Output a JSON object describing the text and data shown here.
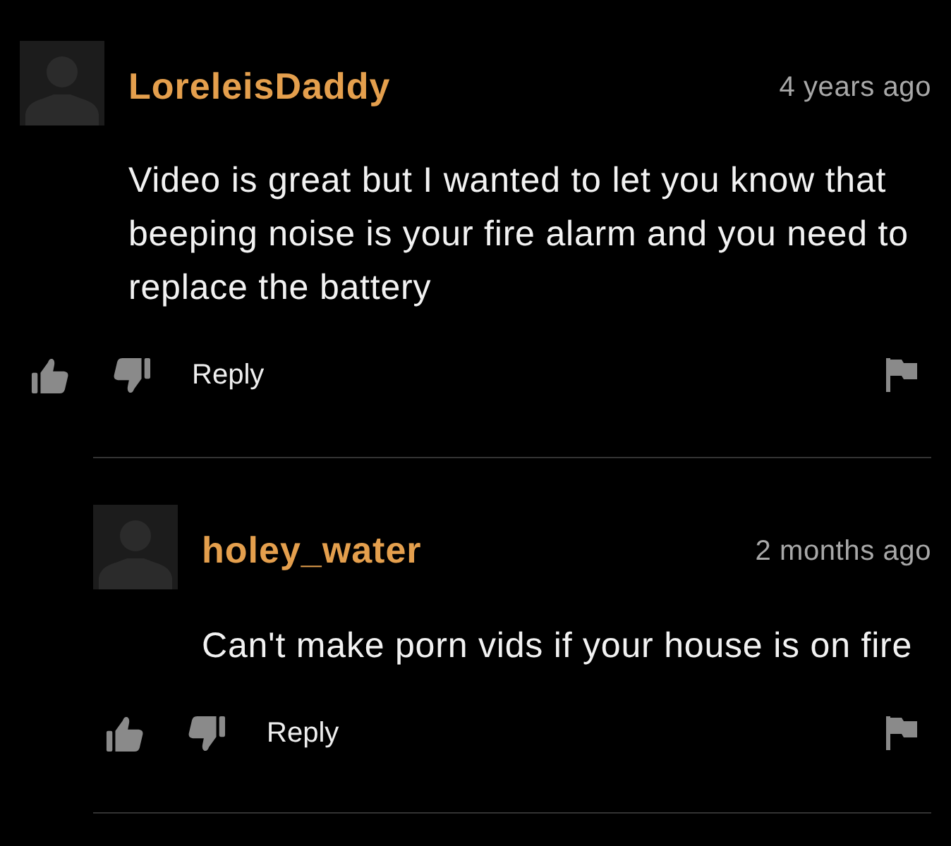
{
  "comments": [
    {
      "author": "LoreleisDaddy",
      "time": "4 years ago",
      "text": "Video is great but I wanted to let you know that beeping noise is your fire alarm and you need to replace the battery",
      "reply": "Reply",
      "children": [
        {
          "author": "holey_water",
          "time": "2 months ago",
          "text": "Can't make porn vids if your house is on fire",
          "reply": "Reply"
        }
      ]
    }
  ]
}
